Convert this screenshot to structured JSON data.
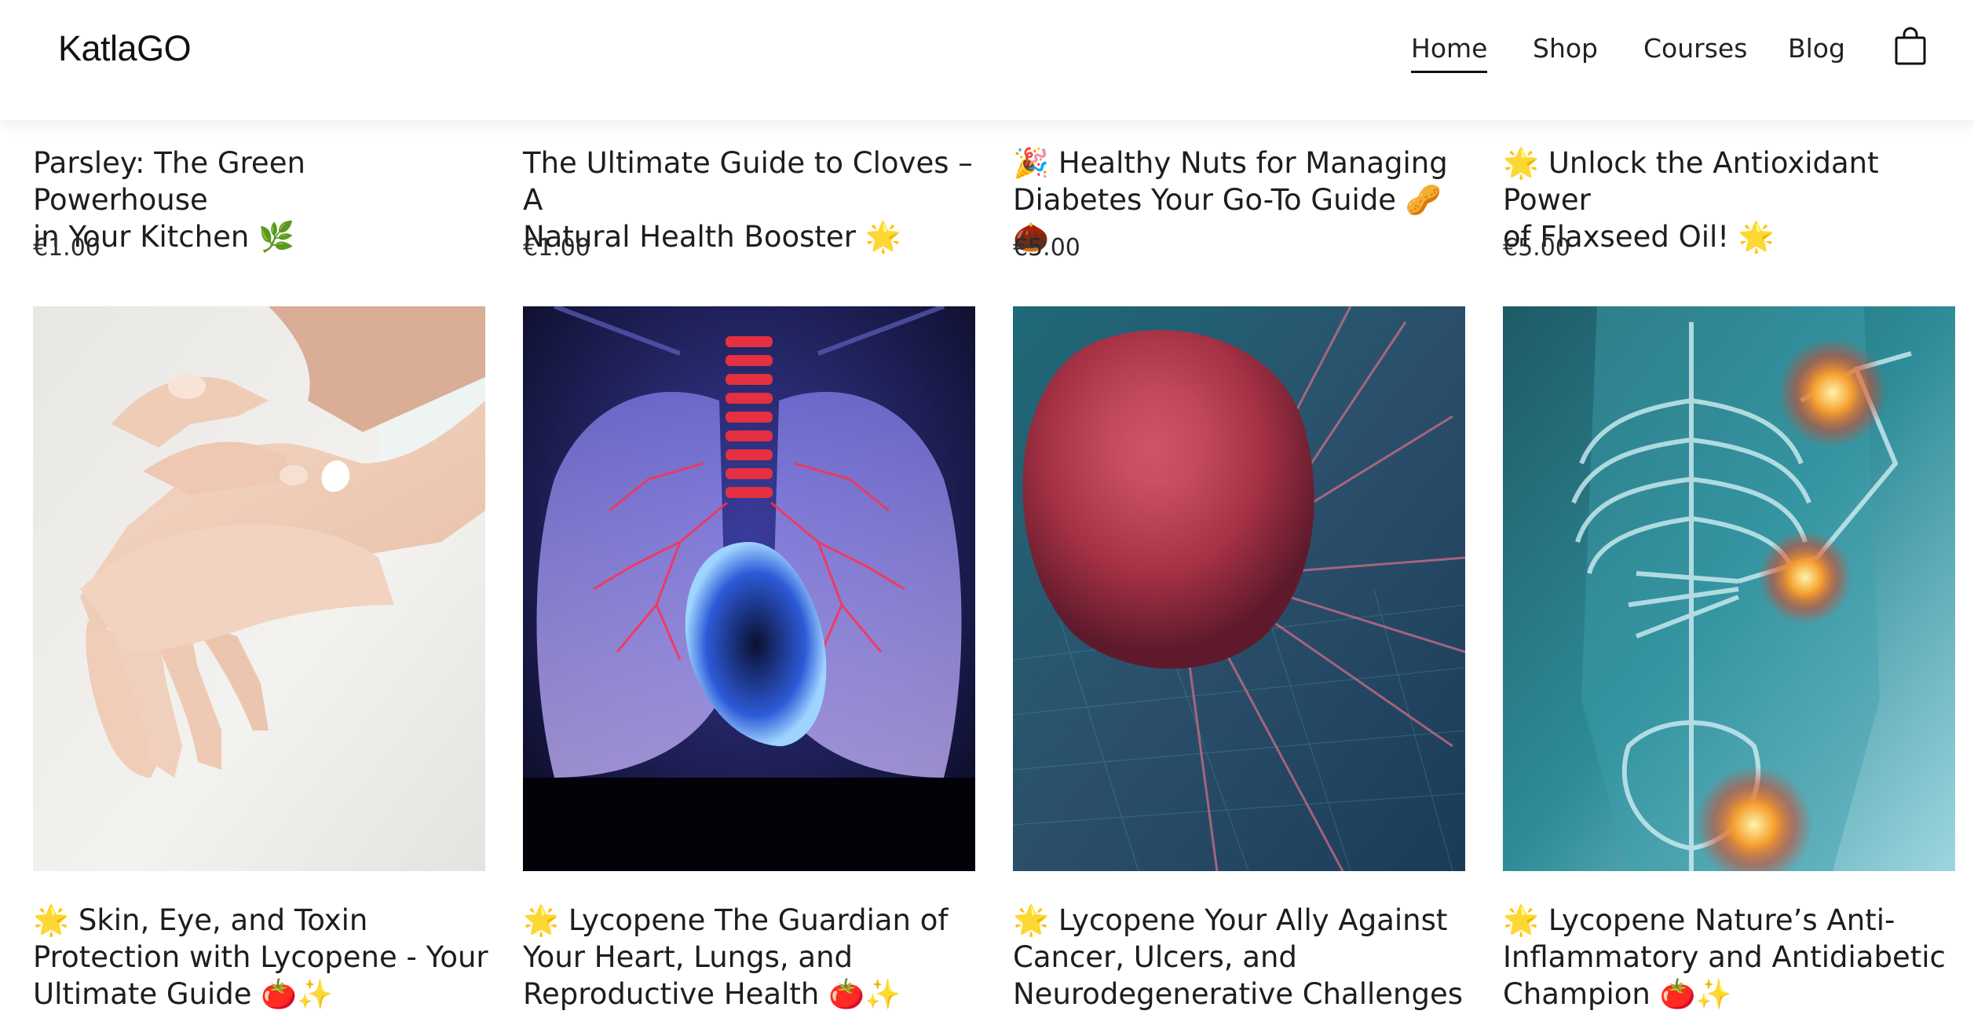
{
  "header": {
    "logo": "KatlaGO",
    "nav": [
      {
        "label": "Home",
        "active": true
      },
      {
        "label": "Shop",
        "active": false
      },
      {
        "label": "Courses",
        "active": false
      },
      {
        "label": "Blog",
        "active": false
      }
    ],
    "cart_icon": "shopping-bag-icon"
  },
  "products_row1": [
    {
      "title_line1": "Parsley: The Green Powerhouse",
      "title_line2": "in Your Kitchen 🌿",
      "price": "€1.00"
    },
    {
      "title_line1": "The Ultimate Guide to Cloves – A",
      "title_line2": "Natural Health Booster 🌟",
      "price": "€1.00"
    },
    {
      "title_line1": "🎉 Healthy Nuts for Managing",
      "title_line2": "Diabetes Your Go-To Guide 🥜🌰",
      "price": "€5.00"
    },
    {
      "title_line1": "🌟 Unlock the Antioxidant Power",
      "title_line2": "of Flaxseed Oil! 🌟",
      "price": "€5.00"
    }
  ],
  "products_row2": [
    {
      "image": "hand-applying-cream-image",
      "title_line1": "🌟 Skin, Eye, and Toxin",
      "title_line2": "Protection with Lycopene - Your",
      "title_line3": "Ultimate Guide 🍅✨"
    },
    {
      "image": "lungs-and-heart-xray-image",
      "title_line1": "🌟 Lycopene The Guardian of",
      "title_line2": "Your Heart, Lungs, and",
      "title_line3": "Reproductive Health 🍅✨"
    },
    {
      "image": "cancer-cell-microscope-image",
      "title_line1": "🌟 Lycopene Your Ally Against",
      "title_line2": "Cancer, Ulcers, and",
      "title_line3": "Neurodegenerative Challenges"
    },
    {
      "image": "skeleton-joint-inflammation-image",
      "title_line1": "🌟 Lycopene Nature’s Anti-",
      "title_line2": "Inflammatory and Antidiabetic",
      "title_line3": "Champion 🍅✨"
    }
  ],
  "colors": {
    "text": "#1d1d1d",
    "header_bg": "#ffffff",
    "page_bg": "#ffffff"
  }
}
